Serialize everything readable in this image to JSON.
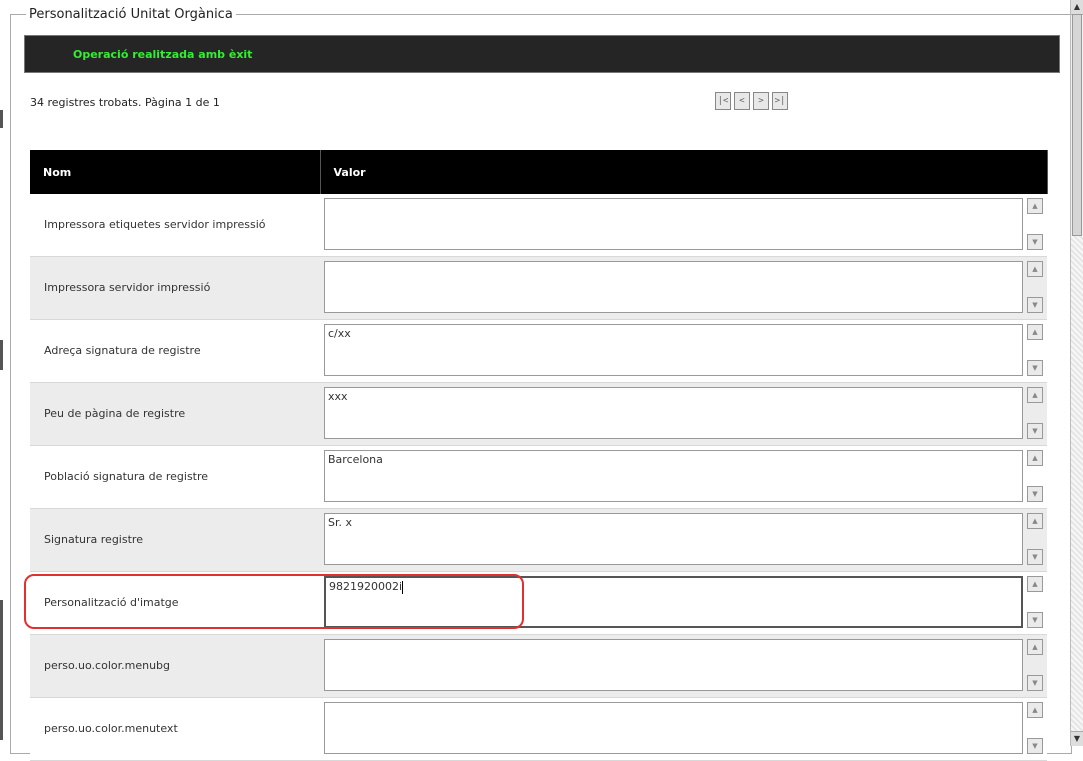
{
  "panel": {
    "legend": "Personalització Unitat Orgànica"
  },
  "banner": {
    "message": "Operació realitzada amb èxit"
  },
  "pager": {
    "summary": "34 registres trobats. Pàgina 1 de 1",
    "first": "|<",
    "prev": "<",
    "next": ">",
    "last": ">|"
  },
  "table": {
    "headers": {
      "name": "Nom",
      "value": "Valor"
    },
    "rows": [
      {
        "name": "Impressora etiquetes servidor impressió",
        "value": ""
      },
      {
        "name": "Impressora servidor impressió",
        "value": ""
      },
      {
        "name": "Adreça signatura de registre",
        "value": "c/xx"
      },
      {
        "name": "Peu de pàgina de registre",
        "value": "xxx"
      },
      {
        "name": "Població signatura de registre",
        "value": "Barcelona"
      },
      {
        "name": "Signatura registre",
        "value": "Sr. x"
      },
      {
        "name": "Personalització d'imatge",
        "value": "9821920002i"
      },
      {
        "name": "perso.uo.color.menubg",
        "value": ""
      },
      {
        "name": "perso.uo.color.menutext",
        "value": ""
      }
    ]
  },
  "icons": {
    "scroll_up": "up-arrow-icon",
    "scroll_down": "down-arrow-icon"
  },
  "colors": {
    "banner_bg": "#252525",
    "success_text": "#33ee33",
    "header_bg": "#000000",
    "highlight": "#e03030"
  }
}
